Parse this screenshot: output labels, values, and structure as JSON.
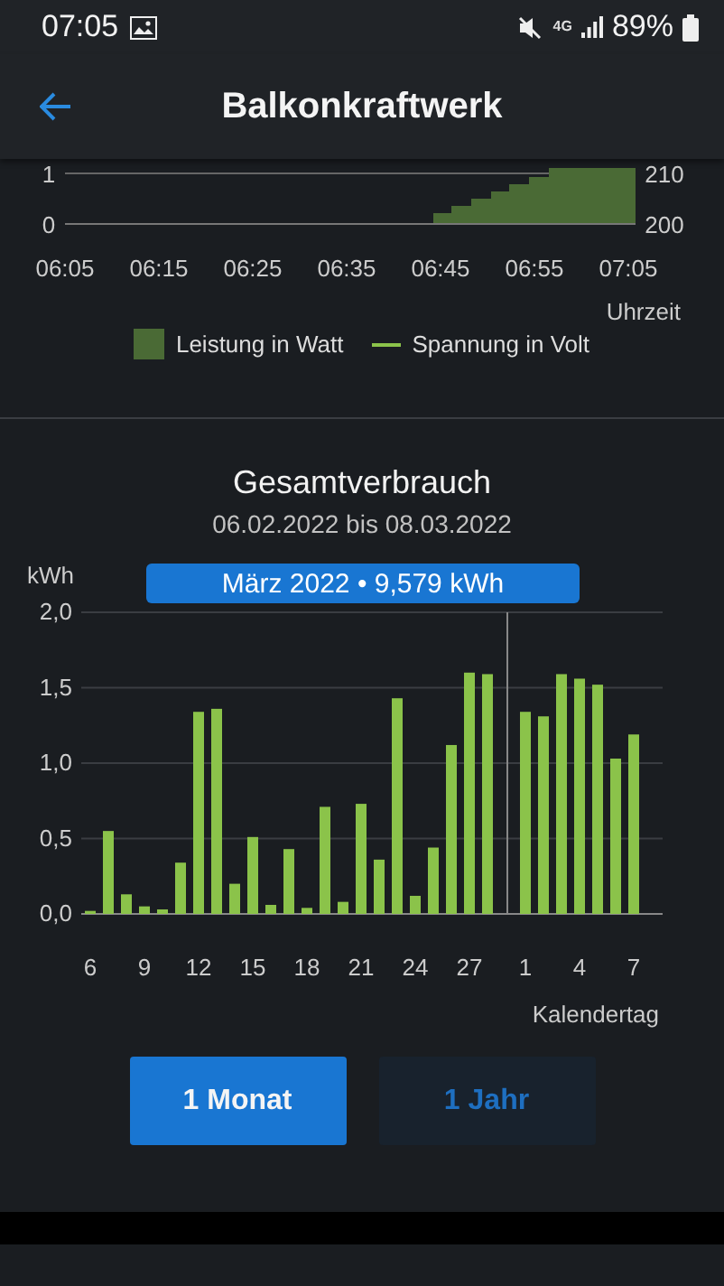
{
  "status_bar": {
    "time": "07:05",
    "network": "4G",
    "battery": "89%"
  },
  "header": {
    "title": "Balkonkraftwerk"
  },
  "power_chart": {
    "y_left_ticks": [
      "1",
      "0"
    ],
    "y_right_ticks": [
      "210",
      "200"
    ],
    "x_ticks": [
      "06:05",
      "06:15",
      "06:25",
      "06:35",
      "06:45",
      "06:55",
      "07:05"
    ],
    "xlabel": "Uhrzeit",
    "legend": [
      {
        "label": "Leistung in Watt",
        "kind": "area",
        "color": "#4a6a35"
      },
      {
        "label": "Spannung in Volt",
        "kind": "line",
        "color": "#8bc34a"
      }
    ]
  },
  "consumption": {
    "title": "Gesamtverbrauch",
    "range": "06.02.2022 bis 08.03.2022",
    "chart_data": {
      "type": "bar",
      "xlabel": "Kalendertag",
      "ylabel": "kWh",
      "categories": [
        "6",
        null,
        null,
        "9",
        null,
        null,
        "12",
        null,
        null,
        "15",
        null,
        null,
        "18",
        null,
        null,
        "21",
        null,
        null,
        "24",
        null,
        null,
        "27",
        null,
        null,
        "1",
        null,
        null,
        "4",
        null,
        null,
        "7"
      ],
      "grid": true,
      "series": [
        {
          "color": "#8bc34a",
          "values": [
            0.02,
            0.55,
            0.13,
            0.05,
            0.03,
            0.34,
            1.34,
            1.36,
            0.2,
            0.51,
            0.06,
            0.43,
            0.04,
            0.71,
            0.08,
            0.73,
            0.36,
            1.43,
            0.12,
            0.44,
            1.12,
            1.6,
            1.59,
            null,
            1.34,
            1.31,
            1.59,
            1.56,
            1.52,
            1.03,
            1.19
          ]
        }
      ],
      "ylim": [
        0,
        2
      ],
      "yticks": [
        {
          "value": 0,
          "label": "0,0"
        },
        {
          "value": 0.5,
          "label": "0,5"
        },
        {
          "value": 1,
          "label": "1,0"
        },
        {
          "value": 1.5,
          "label": "1,5"
        },
        {
          "value": 2,
          "label": "2,0"
        }
      ],
      "annotations": [
        {
          "text": "März 2022 • 9,579 kWh"
        }
      ]
    }
  },
  "buttons": [
    {
      "label": "1 Monat",
      "selected": true
    },
    {
      "label": "1 Jahr",
      "selected": false
    }
  ]
}
